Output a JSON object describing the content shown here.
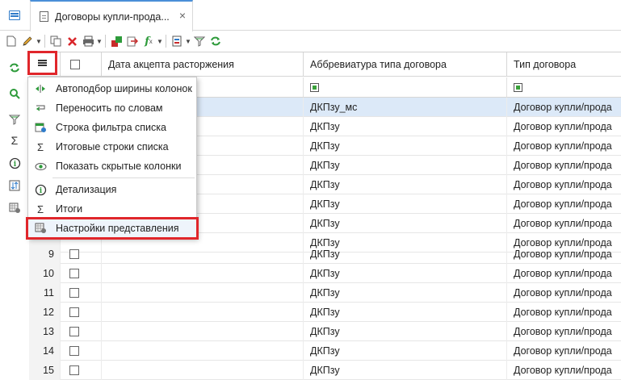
{
  "tab": {
    "title": "Договоры купли-прода...",
    "close": "×"
  },
  "toolbar": {
    "icons": [
      "new-document-icon",
      "edit-icon",
      "copy-icon",
      "delete-icon",
      "print-icon",
      "export-icon",
      "import-icon",
      "formula-icon",
      "report-icon",
      "filter-icon",
      "refresh-icon"
    ]
  },
  "columns": {
    "date": "Дата акцепта расторжения",
    "abbr": "Аббревиатура типа договора",
    "type": "Тип договора"
  },
  "rows": [
    {
      "n": "",
      "abbr": "ДКПзу_мс",
      "type": "Договор купли/прода"
    },
    {
      "n": "",
      "abbr": "ДКПзу",
      "type": "Договор купли/прода"
    },
    {
      "n": "",
      "abbr": "ДКПзу",
      "type": "Договор купли/прода"
    },
    {
      "n": "",
      "abbr": "ДКПзу",
      "type": "Договор купли/прода"
    },
    {
      "n": "",
      "abbr": "ДКПзу",
      "type": "Договор купли/прода"
    },
    {
      "n": "",
      "abbr": "ДКПзу",
      "type": "Договор купли/прода"
    },
    {
      "n": "",
      "abbr": "ДКПзу",
      "type": "Договор купли/прода"
    },
    {
      "n": "",
      "abbr": "ДКПзу",
      "type": "Договор купли/прода"
    },
    {
      "n": "9",
      "abbr": "ДКПзу",
      "type": "Договор купли/прода"
    },
    {
      "n": "10",
      "abbr": "ДКПзу",
      "type": "Договор купли/прода"
    },
    {
      "n": "11",
      "abbr": "ДКПзу",
      "type": "Договор купли/прода"
    },
    {
      "n": "12",
      "abbr": "ДКПзу",
      "type": "Договор купли/прода"
    },
    {
      "n": "13",
      "abbr": "ДКПзу",
      "type": "Договор купли/прода"
    },
    {
      "n": "14",
      "abbr": "ДКПзу",
      "type": "Договор купли/прода"
    },
    {
      "n": "15",
      "abbr": "ДКПзу",
      "type": "Договор купли/прода"
    }
  ],
  "menu": {
    "items": [
      {
        "label": "Автоподбор ширины колонок",
        "icon": "autofit-columns-icon"
      },
      {
        "label": "Переносить по словам",
        "icon": "word-wrap-icon"
      },
      {
        "label": "Строка фильтра списка",
        "icon": "filter-row-icon"
      },
      {
        "label": "Итоговые строки списка",
        "icon": "sum-icon"
      },
      {
        "label": "Показать скрытые колонки",
        "icon": "eye-icon"
      },
      {
        "label": "Детализация",
        "icon": "info-icon"
      },
      {
        "label": "Итоги",
        "icon": "sum-icon"
      },
      {
        "label": "Настройки представления",
        "icon": "view-settings-icon"
      }
    ]
  },
  "colors": {
    "highlight": "#e0262b",
    "selected_row": "#dce9f8",
    "accent": "#2f7bc9"
  }
}
